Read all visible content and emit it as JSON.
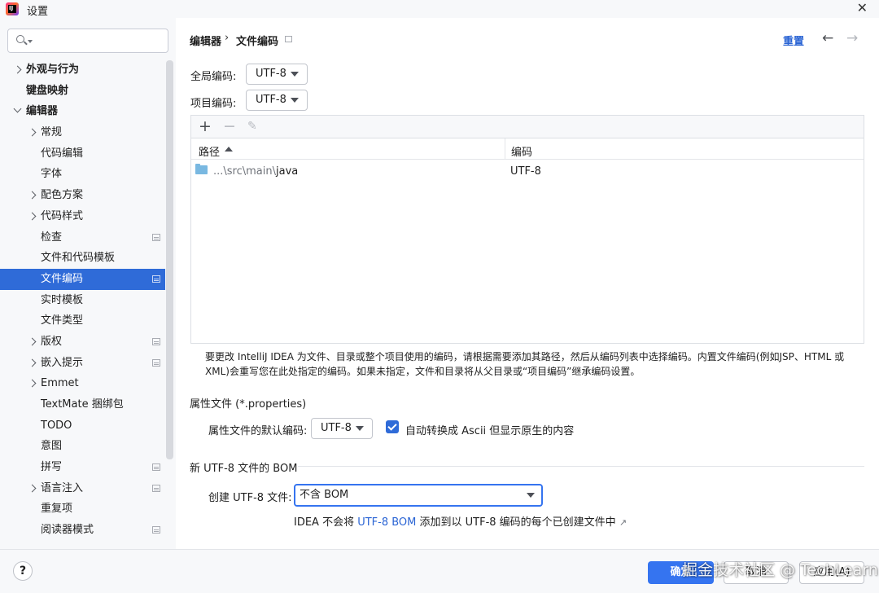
{
  "window": {
    "title": "设置",
    "close_glyph": "✕"
  },
  "search": {
    "placeholder": "",
    "icon": "search-icon"
  },
  "tree": [
    {
      "label": "外观与行为",
      "indent": 0,
      "chevron": "right",
      "bold": true
    },
    {
      "label": "键盘映射",
      "indent": 0,
      "chevron": "none",
      "bold": true
    },
    {
      "label": "编辑器",
      "indent": 0,
      "chevron": "down",
      "bold": true
    },
    {
      "label": "常规",
      "indent": 1,
      "chevron": "right"
    },
    {
      "label": "代码编辑",
      "indent": 1,
      "chevron": "none"
    },
    {
      "label": "字体",
      "indent": 1,
      "chevron": "none"
    },
    {
      "label": "配色方案",
      "indent": 1,
      "chevron": "right"
    },
    {
      "label": "代码样式",
      "indent": 1,
      "chevron": "right"
    },
    {
      "label": "检查",
      "indent": 1,
      "chevron": "none",
      "page_icon": true
    },
    {
      "label": "文件和代码模板",
      "indent": 1,
      "chevron": "none"
    },
    {
      "label": "文件编码",
      "indent": 1,
      "chevron": "none",
      "page_icon": true,
      "selected": true
    },
    {
      "label": "实时模板",
      "indent": 1,
      "chevron": "none"
    },
    {
      "label": "文件类型",
      "indent": 1,
      "chevron": "none"
    },
    {
      "label": "版权",
      "indent": 1,
      "chevron": "right",
      "page_icon": true
    },
    {
      "label": "嵌入提示",
      "indent": 1,
      "chevron": "right",
      "page_icon": true
    },
    {
      "label": "Emmet",
      "indent": 1,
      "chevron": "right"
    },
    {
      "label": "TextMate 捆绑包",
      "indent": 1,
      "chevron": "none"
    },
    {
      "label": "TODO",
      "indent": 1,
      "chevron": "none"
    },
    {
      "label": "意图",
      "indent": 1,
      "chevron": "none"
    },
    {
      "label": "拼写",
      "indent": 1,
      "chevron": "none",
      "page_icon": true
    },
    {
      "label": "语言注入",
      "indent": 1,
      "chevron": "right",
      "page_icon": true
    },
    {
      "label": "重复项",
      "indent": 1,
      "chevron": "none"
    },
    {
      "label": "阅读器模式",
      "indent": 1,
      "chevron": "none",
      "page_icon": true
    }
  ],
  "header": {
    "crumb_parent": "编辑器",
    "crumb_sep": "›",
    "crumb_current": "文件编码",
    "reset_label": "重置",
    "back_glyph": "←",
    "forward_glyph": "→"
  },
  "global_encoding": {
    "label": "全局编码:",
    "value": "UTF-8"
  },
  "project_encoding": {
    "label": "项目编码:",
    "value": "UTF-8"
  },
  "table": {
    "toolbar": {
      "add": "+",
      "remove": "−",
      "edit": "✎"
    },
    "columns": [
      "路径",
      "编码"
    ],
    "rows": [
      {
        "path_prefix": "...\\src\\main\\",
        "path_leaf": "java",
        "encoding": "UTF-8"
      }
    ]
  },
  "description": "要更改 IntelliJ IDEA 为文件、目录或整个项目使用的编码，请根据需要添加其路径，然后从编码列表中选择编码。内置文件编码(例如JSP、HTML 或 XML)会重写您在此处指定的编码。如果未指定，文件和目录将从父目录或“项目编码”继承编码设置。",
  "properties": {
    "section_title": "属性文件 (*.properties)",
    "default_label": "属性文件的默认编码:",
    "default_value": "UTF-8",
    "ascii_checkbox_label": "自动转换成 Ascii 但显示原生的内容",
    "ascii_checked": true
  },
  "bom": {
    "section_title": "新 UTF-8 文件的 BOM",
    "create_label": "创建 UTF-8 文件:",
    "create_value": "不含 BOM",
    "hint_before": "IDEA 不会将 ",
    "hint_link": "UTF-8 BOM",
    "hint_after": " 添加到以 UTF-8 编码的每个已创建文件中",
    "hint_arrow": "↗"
  },
  "footer": {
    "help": "?",
    "ok": "确定",
    "cancel": "取消",
    "apply": "应用(A)",
    "watermark": "掘金技术社区 @ TechLearn"
  },
  "colors": {
    "accent": "#3574f0",
    "selection": "#2f6bd8",
    "link": "#2a64d4"
  }
}
